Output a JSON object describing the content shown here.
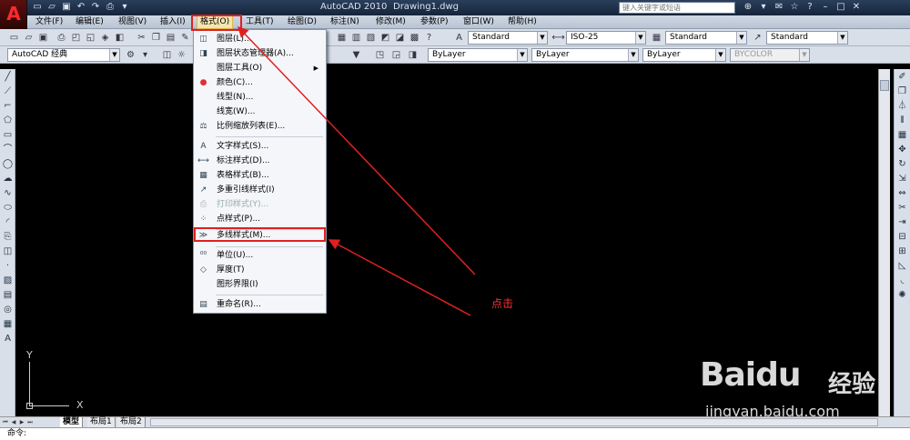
{
  "title_bar": {
    "app_name": "AutoCAD 2010",
    "document": "Drawing1.dwg",
    "search_placeholder": "键入关键字或短语"
  },
  "menu_bar": {
    "items": [
      "文件(F)",
      "编辑(E)",
      "视图(V)",
      "插入(I)",
      "格式(O)",
      "工具(T)",
      "绘图(D)",
      "标注(N)",
      "修改(M)",
      "参数(P)",
      "窗口(W)",
      "帮助(H)"
    ],
    "active_index": 4
  },
  "toolbar": {
    "workspace": "AutoCAD 经典",
    "text_style": "Standard",
    "dim_style": "ISO-25",
    "table_style": "Standard",
    "mleader_style": "Standard",
    "color": "ByLayer",
    "linetype": "ByLayer",
    "lineweight": "ByLayer",
    "plot_style": "BYCOLOR"
  },
  "format_menu": {
    "items": [
      {
        "icon": "layer-icon",
        "label": "图层(L)...",
        "enabled": true,
        "submenu": false
      },
      {
        "icon": "layer-state-icon",
        "label": "图层状态管理器(A)...",
        "enabled": true,
        "submenu": false
      },
      {
        "icon": "",
        "label": "图层工具(O)",
        "enabled": true,
        "submenu": true
      },
      {
        "icon": "color-wheel-icon",
        "label": "颜色(C)...",
        "enabled": true,
        "submenu": false
      },
      {
        "icon": "",
        "label": "线型(N)...",
        "enabled": true,
        "submenu": false
      },
      {
        "icon": "",
        "label": "线宽(W)...",
        "enabled": true,
        "submenu": false
      },
      {
        "icon": "scale-list-icon",
        "label": "比例缩放列表(E)...",
        "enabled": true,
        "submenu": false
      },
      {
        "icon": "text-style-icon",
        "label": "文字样式(S)...",
        "enabled": true,
        "submenu": false
      },
      {
        "icon": "dim-style-icon",
        "label": "标注样式(D)...",
        "enabled": true,
        "submenu": false
      },
      {
        "icon": "table-style-icon",
        "label": "表格样式(B)...",
        "enabled": true,
        "submenu": false
      },
      {
        "icon": "mleader-style-icon",
        "label": "多重引线样式(I)",
        "enabled": true,
        "submenu": false
      },
      {
        "icon": "plot-style-icon",
        "label": "打印样式(Y)...",
        "enabled": false,
        "submenu": false
      },
      {
        "icon": "point-style-icon",
        "label": "点样式(P)...",
        "enabled": true,
        "submenu": false
      },
      {
        "icon": "mline-style-icon",
        "label": "多线样式(M)...",
        "enabled": true,
        "submenu": false
      },
      {
        "icon": "units-icon",
        "label": "单位(U)...",
        "enabled": true,
        "submenu": false
      },
      {
        "icon": "thickness-icon",
        "label": "厚度(T)",
        "enabled": true,
        "submenu": false
      },
      {
        "icon": "",
        "label": "图形界限(I)",
        "enabled": true,
        "submenu": false
      },
      {
        "icon": "rename-icon",
        "label": "重命名(R)...",
        "enabled": true,
        "submenu": false
      }
    ],
    "highlighted_index": 13
  },
  "annotation": {
    "label": "点击",
    "color": "#e02020"
  },
  "ucs": {
    "x_label": "X",
    "y_label": "Y"
  },
  "layout_tabs": [
    "模型",
    "布局1",
    "布局2"
  ],
  "command_prompt": "命令:",
  "watermark": {
    "brand": "Baidu",
    "cn": "经验",
    "url": "jingyan.baidu.com"
  }
}
